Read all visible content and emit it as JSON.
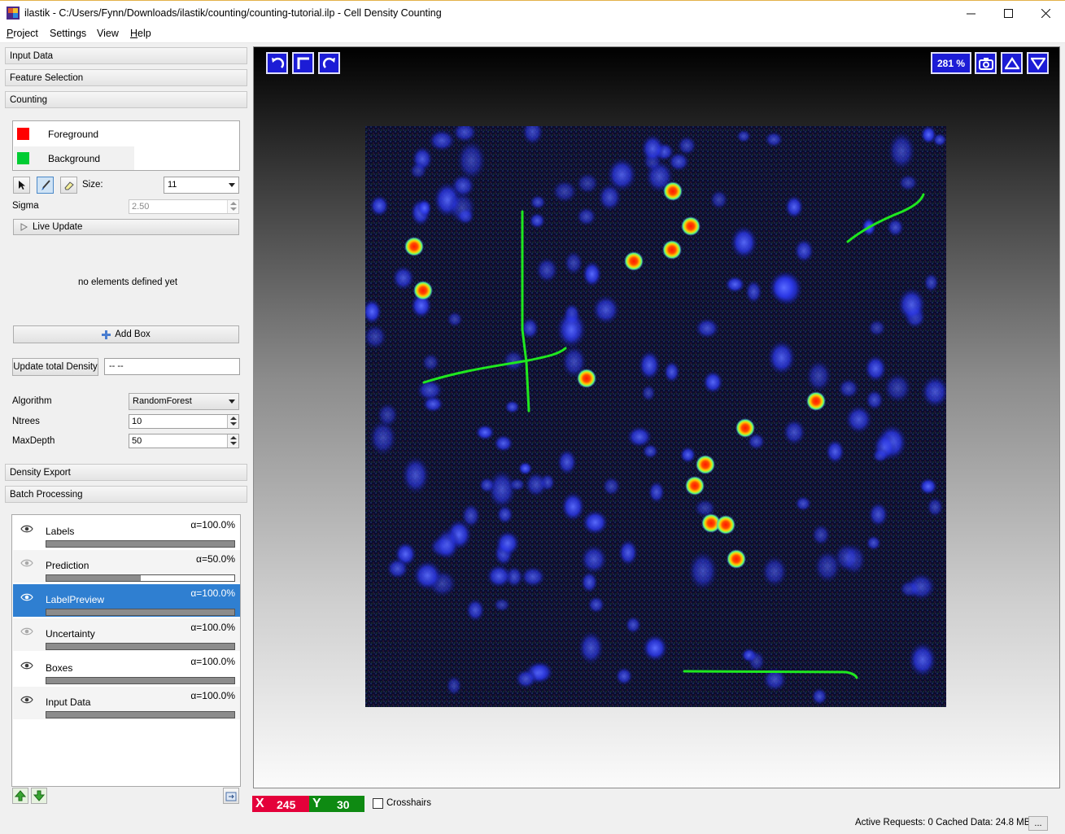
{
  "window": {
    "title": "ilastik - C:/Users/Fynn/Downloads/ilastik/counting/counting-tutorial.ilp - Cell Density Counting",
    "controls": [
      "minimize-icon",
      "maximize-icon",
      "close-icon"
    ]
  },
  "menu": {
    "items": [
      {
        "label": "Project",
        "accel": "P",
        "rest": "roject"
      },
      {
        "label": "Settings"
      },
      {
        "label": "View"
      },
      {
        "label": "Help",
        "accel": "H",
        "rest": "elp"
      }
    ]
  },
  "applets": {
    "input_data": "Input Data",
    "feature_selection": "Feature Selection",
    "counting": "Counting",
    "density_export": "Density Export",
    "batch_processing": "Batch Processing"
  },
  "labels": [
    {
      "name": "Foreground",
      "color": "#ff0000"
    },
    {
      "name": "Background",
      "color": "#00cc33"
    }
  ],
  "brush": {
    "size_label": "Size:",
    "size_value": "11"
  },
  "sigma": {
    "label": "Sigma",
    "value": "2.50"
  },
  "live_update": "Live Update",
  "boxes_empty": "no elements defined yet",
  "add_box": "Add Box",
  "update_density": {
    "button": "Update total Density",
    "value": "-- --"
  },
  "classifier": {
    "algorithm_label": "Algorithm",
    "algorithm_value": "RandomForest",
    "ntrees_label": "Ntrees",
    "ntrees_value": "10",
    "maxdepth_label": "MaxDepth",
    "maxdepth_value": "50"
  },
  "layers": [
    {
      "name": "Labels",
      "alpha": "α=100.0%",
      "opacity": 1.0,
      "visible": true,
      "selected": false
    },
    {
      "name": "Prediction",
      "alpha": "α=50.0%",
      "opacity": 0.5,
      "visible": false,
      "selected": false
    },
    {
      "name": "LabelPreview",
      "alpha": "α=100.0%",
      "opacity": 1.0,
      "visible": true,
      "selected": true
    },
    {
      "name": "Uncertainty",
      "alpha": "α=100.0%",
      "opacity": 1.0,
      "visible": false,
      "selected": false
    },
    {
      "name": "Boxes",
      "alpha": "α=100.0%",
      "opacity": 1.0,
      "visible": true,
      "selected": false
    },
    {
      "name": "Input Data",
      "alpha": "α=100.0%",
      "opacity": 1.0,
      "visible": true,
      "selected": false
    }
  ],
  "viewer": {
    "zoom": "281 %",
    "accent": "#1c1cd6"
  },
  "position": {
    "x_label": "X",
    "x_value": "245",
    "y_label": "Y",
    "y_value": "30"
  },
  "crosshairs": "Crosshairs",
  "status": {
    "text": "Active Requests: 0  Cached Data: 24.8 MB",
    "more": "..."
  }
}
